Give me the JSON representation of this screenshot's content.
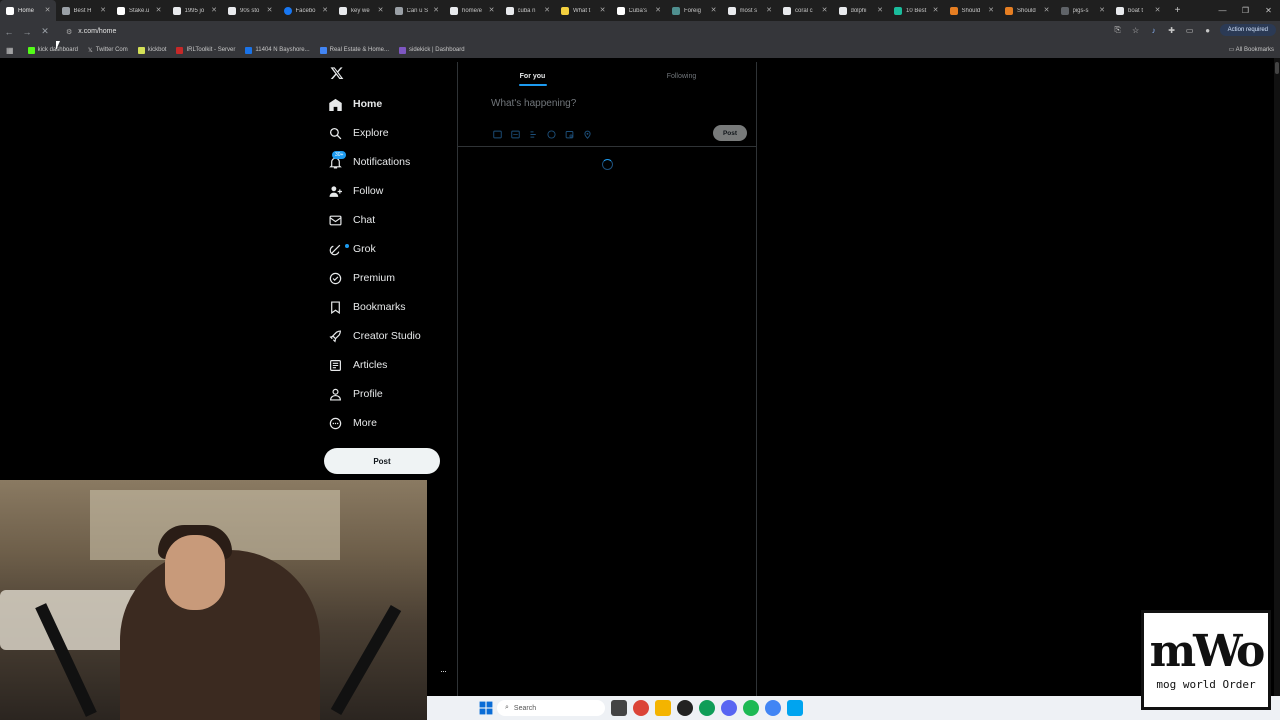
{
  "browser": {
    "tabs": [
      {
        "title": "Home",
        "favicon_color": "#ffffff",
        "active": true
      },
      {
        "title": "Best H",
        "favicon_color": "#9aa0a6"
      },
      {
        "title": "Stake.u",
        "favicon_color": "#ffffff"
      },
      {
        "title": "1995 jo",
        "favicon_color": "#e8eaed"
      },
      {
        "title": "90s sto",
        "favicon_color": "#e8eaed"
      },
      {
        "title": "Facebo",
        "favicon_color": "#1877f2"
      },
      {
        "title": "key we",
        "favicon_color": "#e8eaed"
      },
      {
        "title": "Can u S",
        "favicon_color": "#9aa0a6"
      },
      {
        "title": "home/e",
        "favicon_color": "#e8eaed"
      },
      {
        "title": "cuba n",
        "favicon_color": "#e8eaed"
      },
      {
        "title": "What t",
        "favicon_color": "#f4d03f"
      },
      {
        "title": "Cuba's",
        "favicon_color": "#ffffff"
      },
      {
        "title": "Foreig",
        "favicon_color": "#4f8f8f"
      },
      {
        "title": "most s",
        "favicon_color": "#e8eaed"
      },
      {
        "title": "coral c",
        "favicon_color": "#e8eaed"
      },
      {
        "title": "dolphi",
        "favicon_color": "#e8eaed"
      },
      {
        "title": "10 Best",
        "favicon_color": "#1abc9c"
      },
      {
        "title": "Should",
        "favicon_color": "#e67e22"
      },
      {
        "title": "Should",
        "favicon_color": "#e67e22"
      },
      {
        "title": "pigs-s",
        "favicon_color": "#5f6368"
      },
      {
        "title": "boat t",
        "favicon_color": "#e8eaed"
      }
    ],
    "new_tab": "+",
    "url": "x.com/home",
    "action_required": "Action required",
    "bookmarks": [
      {
        "label": "kick dashboard",
        "color": "#53fc18"
      },
      {
        "label": "Twitter Com",
        "color": "#ffffff"
      },
      {
        "label": "kickbot",
        "color": "#d4e157"
      },
      {
        "label": "IRLToolkit - Server",
        "color": "#c62828"
      },
      {
        "label": "11404 N Bayshore...",
        "color": "#1a73e8"
      },
      {
        "label": "Real Estate & Home...",
        "color": "#4285f4"
      },
      {
        "label": "sidekick | Dashboard",
        "color": "#7e57c2"
      }
    ],
    "all_bookmarks": "All Bookmarks"
  },
  "sidebar": {
    "items": [
      {
        "label": "Home",
        "icon": "home-icon"
      },
      {
        "label": "Explore",
        "icon": "search-icon"
      },
      {
        "label": "Notifications",
        "icon": "bell-icon"
      },
      {
        "label": "Follow",
        "icon": "follow-icon"
      },
      {
        "label": "Chat",
        "icon": "mail-icon"
      },
      {
        "label": "Grok",
        "icon": "grok-icon"
      },
      {
        "label": "Premium",
        "icon": "premium-icon"
      },
      {
        "label": "Bookmarks",
        "icon": "bookmark-icon"
      },
      {
        "label": "Creator Studio",
        "icon": "rocket-icon"
      },
      {
        "label": "Articles",
        "icon": "articles-icon"
      },
      {
        "label": "Profile",
        "icon": "person-icon"
      },
      {
        "label": "More",
        "icon": "more-icon"
      }
    ],
    "notifications_badge": "30+",
    "post_button": "Post",
    "more_dots": "···"
  },
  "feed": {
    "tabs": [
      "For you",
      "Following"
    ],
    "composer_placeholder": "What's happening?",
    "post_button": "Post"
  },
  "taskbar": {
    "search_placeholder": "Search"
  },
  "watermark": {
    "main": "mWo",
    "sub": "mog world Order"
  },
  "colors": {
    "accent": "#1d9bf0",
    "background": "#000000",
    "border": "#2f3336"
  }
}
